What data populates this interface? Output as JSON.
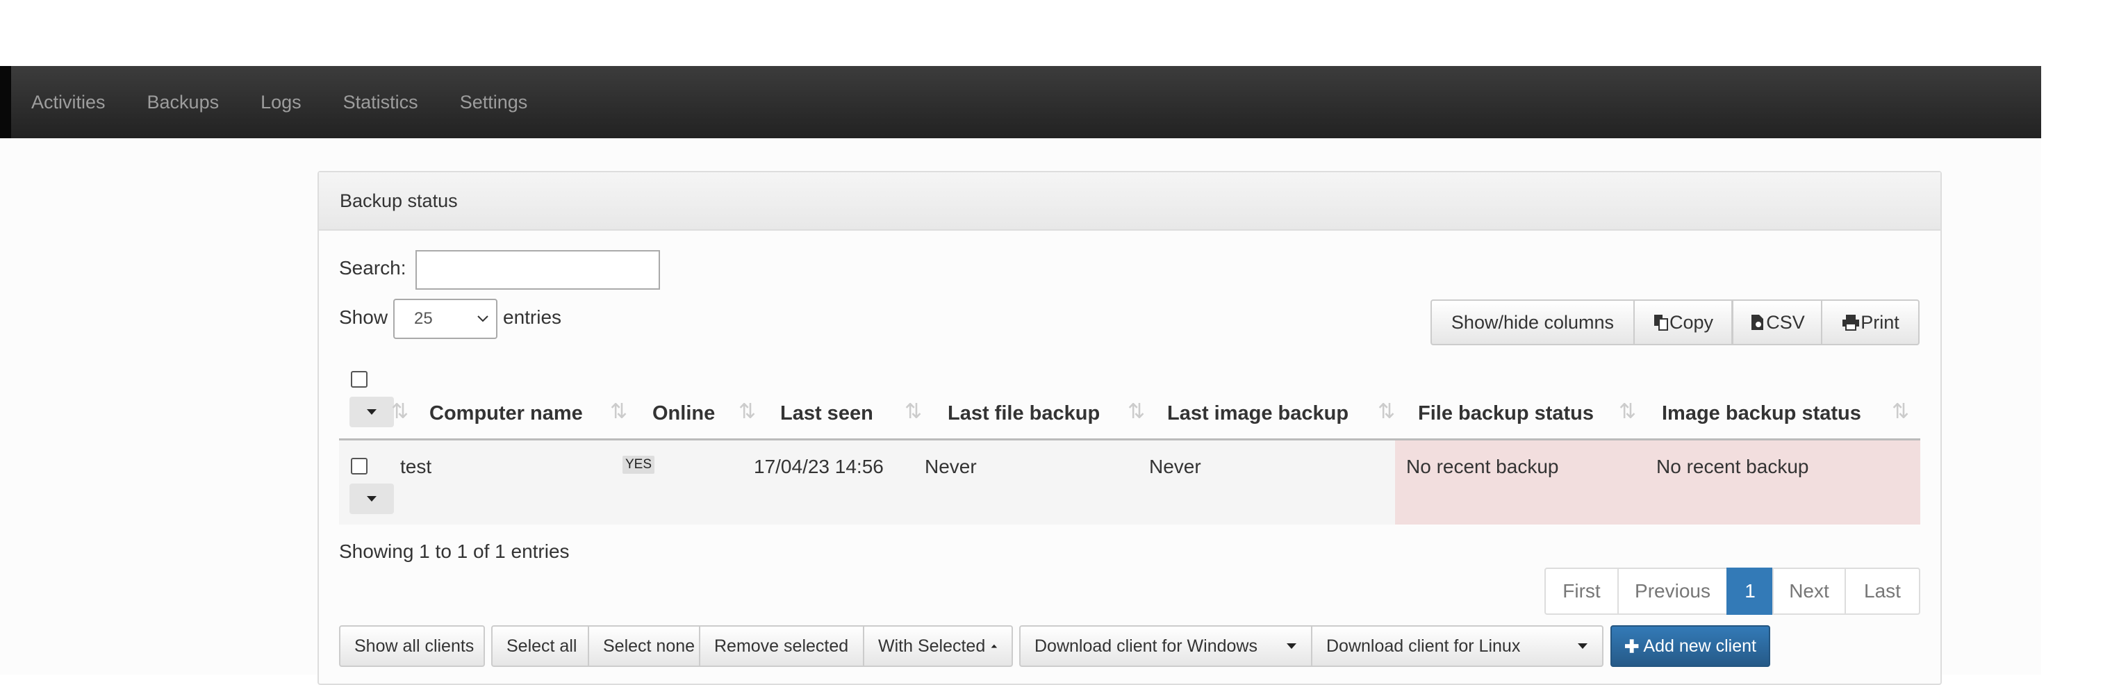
{
  "nav": {
    "items": [
      "Activities",
      "Backups",
      "Logs",
      "Statistics",
      "Settings"
    ]
  },
  "panel": {
    "title": "Backup status"
  },
  "controls": {
    "search_label": "Search:",
    "search_value": "",
    "show_label": "Show",
    "entries_label": "entries",
    "page_length": "25"
  },
  "toolbar": {
    "show_hide_columns": "Show/hide columns",
    "copy": "Copy",
    "csv": "CSV",
    "print": "Print"
  },
  "table": {
    "headers": [
      "Computer name",
      "Online",
      "Last seen",
      "Last file backup",
      "Last image backup",
      "File backup status",
      "Image backup status"
    ],
    "rows": [
      {
        "computer_name": "test",
        "online": "YES",
        "last_seen": "17/04/23 14:56",
        "last_file_backup": "Never",
        "last_image_backup": "Never",
        "file_backup_status": "No recent backup",
        "image_backup_status": "No recent backup"
      }
    ]
  },
  "info": "Showing 1 to 1 of 1 entries",
  "pager": {
    "first": "First",
    "previous": "Previous",
    "current": "1",
    "next": "Next",
    "last": "Last"
  },
  "bottom": {
    "show_all_clients": "Show all clients",
    "select_all": "Select all",
    "select_none": "Select none",
    "remove_selected": "Remove selected",
    "with_selected": "With Selected",
    "download_windows": "Download client for Windows",
    "download_linux": "Download client for Linux",
    "add_new_client": "Add new client"
  },
  "colors": {
    "primary": "#337ab7",
    "danger_row": "#f2dede",
    "navbar": "#222222"
  }
}
